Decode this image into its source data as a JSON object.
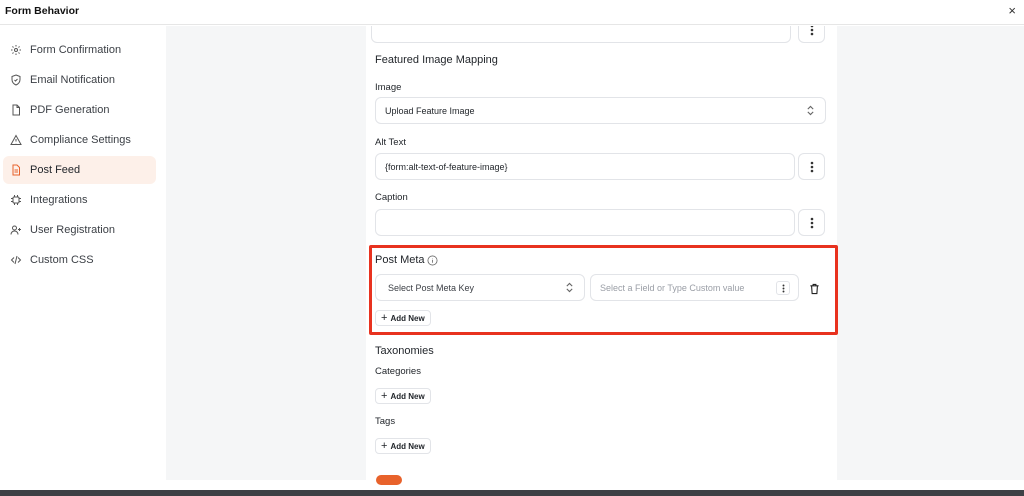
{
  "window": {
    "title": "Form Behavior",
    "close_glyph": "×"
  },
  "sidebar": {
    "items": [
      {
        "label": "Form Confirmation",
        "icon": "gear-icon"
      },
      {
        "label": "Email Notification",
        "icon": "shield-icon"
      },
      {
        "label": "PDF Generation",
        "icon": "file-icon"
      },
      {
        "label": "Compliance Settings",
        "icon": "warning-icon"
      },
      {
        "label": "Post Feed",
        "icon": "document-icon",
        "active": true
      },
      {
        "label": "Integrations",
        "icon": "chip-icon"
      },
      {
        "label": "User Registration",
        "icon": "user-plus-icon"
      },
      {
        "label": "Custom CSS",
        "icon": "code-icon"
      }
    ]
  },
  "featured_image": {
    "title": "Featured Image Mapping",
    "image_label": "Image",
    "image_value": "Upload Feature Image",
    "alt_label": "Alt Text",
    "alt_value": "{form:alt-text-of-feature-image}",
    "caption_label": "Caption",
    "caption_value": ""
  },
  "post_meta": {
    "title": "Post Meta",
    "key_placeholder": "Select Post Meta Key",
    "value_placeholder": "Select a Field or Type Custom value",
    "add_label": "Add New"
  },
  "taxonomies": {
    "title": "Taxonomies",
    "categories_label": "Categories",
    "tags_label": "Tags",
    "add_label": "Add New"
  },
  "colors": {
    "accent": "#e8622b",
    "highlight": "#e8321f",
    "active_bg": "#fdf0e9"
  }
}
